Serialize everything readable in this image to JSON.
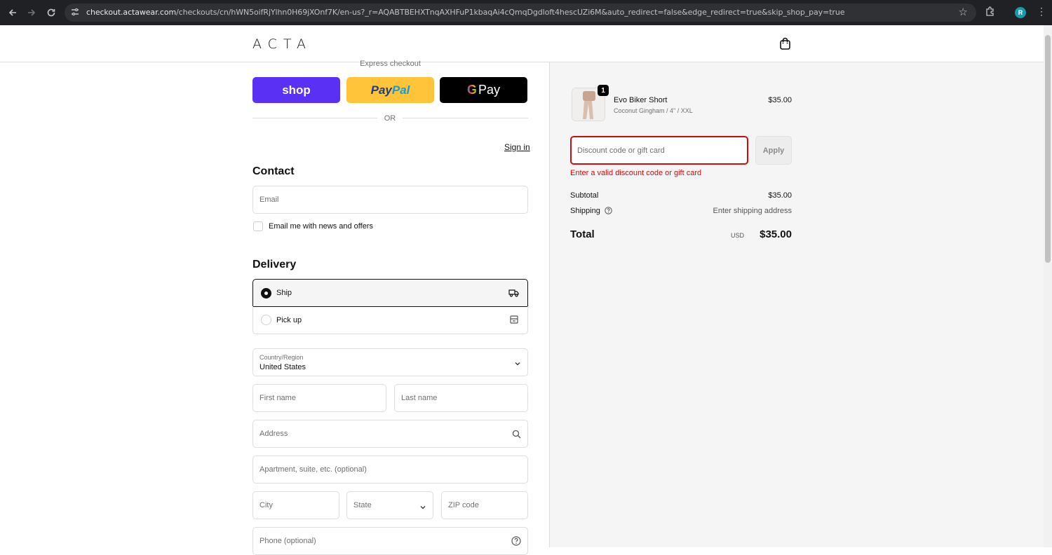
{
  "browser": {
    "url_host": "checkout.actawear.com",
    "url_path": "/checkouts/cn/hWN5oifRjYlhn0H69jXOnf7K/en-us?_r=AQABTBEHXTnqAXHFuP1kbaqAi4cQmqDgdloft4hescUZi6M&auto_redirect=false&edge_redirect=true&skip_shop_pay=true",
    "profile_initial": "R"
  },
  "header": {
    "logo": "ACTA"
  },
  "express": {
    "label": "Express checkout",
    "shop_label": "shop",
    "paypal_part1": "Pay",
    "paypal_part2": "Pal",
    "gpay_g": "G",
    "gpay_label": "Pay",
    "or": "OR"
  },
  "contact": {
    "title": "Contact",
    "sign_in": "Sign in",
    "email_placeholder": "Email",
    "newsletter_label": "Email me with news and offers"
  },
  "delivery": {
    "title": "Delivery",
    "ship_label": "Ship",
    "pickup_label": "Pick up",
    "country_label": "Country/Region",
    "country_value": "United States",
    "first_name": "First name",
    "last_name": "Last name",
    "address": "Address",
    "apartment": "Apartment, suite, etc. (optional)",
    "city": "City",
    "state": "State",
    "zip": "ZIP code",
    "phone": "Phone (optional)"
  },
  "summary": {
    "product_name": "Evo Biker Short",
    "product_variant": "Coconut Gingham / 4\" / XXL",
    "product_price": "$35.00",
    "quantity": "1",
    "discount_placeholder": "Discount code or gift card",
    "apply_label": "Apply",
    "error": "Enter a valid discount code or gift card",
    "subtotal_label": "Subtotal",
    "subtotal_value": "$35.00",
    "shipping_label": "Shipping",
    "shipping_value": "Enter shipping address",
    "total_label": "Total",
    "currency": "USD",
    "total_value": "$35.00"
  },
  "colors": {
    "shop_purple": "#5a31f4",
    "paypal_yellow": "#ffc439",
    "error_red": "#d00b0b"
  }
}
